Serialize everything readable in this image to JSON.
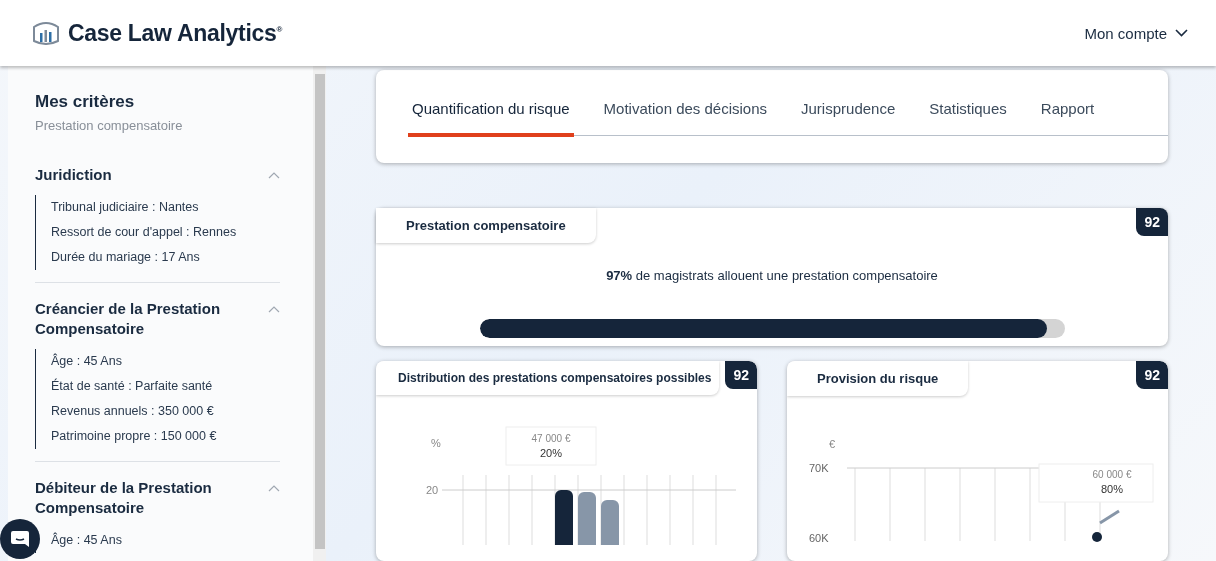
{
  "header": {
    "logo": "Case Law Analytics$^{®}$",
    "account_menu": "Mon compte"
  },
  "sidebar": {
    "title": "Mes critères",
    "subtitle": "Prestation compensatoire",
    "sections": [
      {
        "title": "Juridiction",
        "expanded": true,
        "items": [
          "Tribunal judiciaire : Nantes",
          "Ressort de cour d'appel : Rennes",
          "Durée du mariage : 17 Ans"
        ]
      },
      {
        "title": "Créancier de la Prestation Compensatoire",
        "expanded": true,
        "items": [
          "Âge : 45 Ans",
          "État de santé : Parfaite santé",
          "Revenus annuels : 350 000 €",
          "Patrimoine propre : 150 000 €"
        ]
      },
      {
        "title": "Débiteur de la Prestation Compensatoire",
        "expanded": true,
        "items": [
          "Âge : 45 Ans"
        ]
      }
    ]
  },
  "tabs": [
    {
      "label": "Quantification du risque",
      "selected": true
    },
    {
      "label": "Motivation des décisions",
      "selected": false
    },
    {
      "label": "Jurisprudence",
      "selected": false
    },
    {
      "label": "Statistiques",
      "selected": false
    },
    {
      "label": "Rapport",
      "selected": false
    }
  ],
  "summary_card": {
    "title": "Prestation compensatoire",
    "score": "92",
    "statement": "**97%** de magistrats allouent une prestation compensatoire",
    "level": 0.97
  },
  "distribution_card": {
    "title": "Distribution des prestations compensatoires possibles",
    "score": "92",
    "y_unit": "%",
    "y_tick": "20",
    "tooltip_amount": "47 000 €",
    "tooltip_share": "20%"
  },
  "provision_card": {
    "title": "Provision du risque",
    "score": "92",
    "y_unit": "€",
    "y_tick_top": "70K",
    "y_tick_next": "60K",
    "tooltip_amount": "60 000 €",
    "tooltip_share": "80%"
  }
}
